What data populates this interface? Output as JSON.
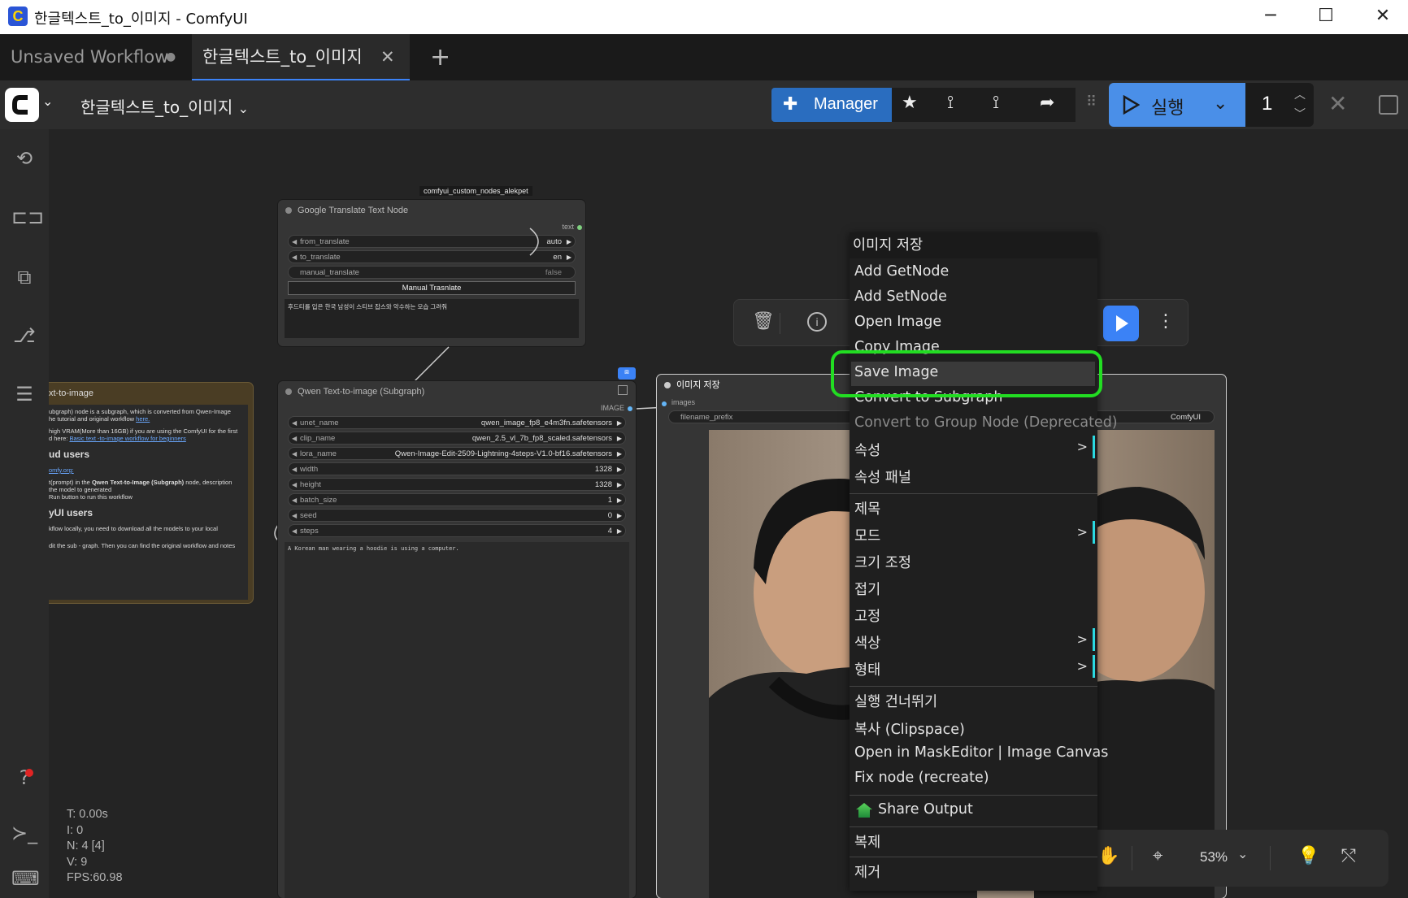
{
  "window": {
    "title": "한글텍스트_to_이미지 - ComfyUI",
    "minimize": "─",
    "maximize": "☐",
    "close": "✕"
  },
  "tabs": [
    {
      "label": "Unsaved Workflow",
      "marker": "●"
    },
    {
      "label": "한글텍스트_to_이미지",
      "marker": "✕"
    }
  ],
  "tabbar": {
    "add": "+"
  },
  "toolbar": {
    "workflow_name": "한글텍스트_to_이미지",
    "manager_label": "Manager",
    "run_label": "실행",
    "queue_count": "1"
  },
  "google_node": {
    "badge": "comfyui_custom_nodes_alekpet",
    "title": "Google Translate Text Node",
    "output": "text",
    "widgets": [
      {
        "name": "from_translate",
        "value": "auto"
      },
      {
        "name": "to_translate",
        "value": "en"
      },
      {
        "name": "manual_translate",
        "value": "false"
      }
    ],
    "button": "Manual Trasnlate",
    "text": "후드티를 입은 한국 남성이 스티브 잡스와 악수하는 모습 그려줘"
  },
  "note_node": {
    "title": "xt-to-image",
    "p1": "ubgraph) node is a subgraph, which is converted from Qwen-Image",
    "p2": "he tutorial and original workflow",
    "p2_link": "here.",
    "p3": " high VRAM(More than 16GB) if you are using the ComfyUI for the first",
    "p4": "d here:",
    "p4_link": "Basic text -to-image workflow for beginners",
    "h1": "ud users",
    "p5_link": "omfy.org:",
    "p6": "t(prompt) in the",
    "p6_bold": "Qwen Text-to-Image (Subgraph)",
    "p6b": "node, description",
    "p7": "the model to generated",
    "p8": "Run button to run this workflow",
    "h2": "yUI users",
    "p9": "kflow locally, you need to download all the models to your local",
    "p10": "dit the sub - graph. Then you can find the original workflow and notes"
  },
  "qwen_node": {
    "title": "Qwen Text-to-image (Subgraph)",
    "output": "IMAGE",
    "widgets": [
      {
        "name": "unet_name",
        "value": "qwen_image_fp8_e4m3fn.safetensors"
      },
      {
        "name": "clip_name",
        "value": "qwen_2.5_vl_7b_fp8_scaled.safetensors"
      },
      {
        "name": "lora_name",
        "value": "Qwen-Image-Edit-2509-Lightning-4steps-V1.0-bf16.safetensors"
      },
      {
        "name": "width",
        "value": "1328"
      },
      {
        "name": "height",
        "value": "1328"
      },
      {
        "name": "batch_size",
        "value": "1"
      },
      {
        "name": "seed",
        "value": "0"
      },
      {
        "name": "steps",
        "value": "4"
      }
    ],
    "prompt": "A Korean man wearing a hoodie is using a computer."
  },
  "save_node": {
    "title": "이미지 저장",
    "input": "images",
    "widget_name": "filename_prefix",
    "widget_value": "ComfyUI"
  },
  "context_menu": {
    "title": "이미지 저장",
    "items": [
      {
        "label": "Add GetNode"
      },
      {
        "label": "Add SetNode"
      },
      {
        "label": "Open Image"
      },
      {
        "label": "Copy Image"
      },
      {
        "label": "Save Image"
      },
      {
        "label": "Convert to Subgraph"
      },
      {
        "label": "Convert to Group Node (Deprecated)"
      },
      {
        "label": "속성"
      },
      {
        "label": "속성 패널"
      },
      {
        "label": "제목"
      },
      {
        "label": "모드"
      },
      {
        "label": "크기 조정"
      },
      {
        "label": "접기"
      },
      {
        "label": "고정"
      },
      {
        "label": "색상"
      },
      {
        "label": "형태"
      },
      {
        "label": "실행 건너뛰기"
      },
      {
        "label": "복사 (Clipspace)"
      },
      {
        "label": "Open in MaskEditor | Image Canvas"
      },
      {
        "label": "Fix node (recreate)"
      },
      {
        "label": "Share Output"
      },
      {
        "label": "복제"
      },
      {
        "label": "제거"
      }
    ],
    "submenu_arrow": ">",
    "highlight_color": "#22dd22"
  },
  "zoom": {
    "label": "53%"
  },
  "stats": {
    "t": "T: 0.00s",
    "i": "I: 0",
    "n": "N: 4 [4]",
    "v": "V: 9",
    "fps": "FPS:60.98"
  },
  "colors": {
    "accent": "#3b82f6",
    "manager": "#2a6dbf",
    "run": "#4a8fe8"
  }
}
